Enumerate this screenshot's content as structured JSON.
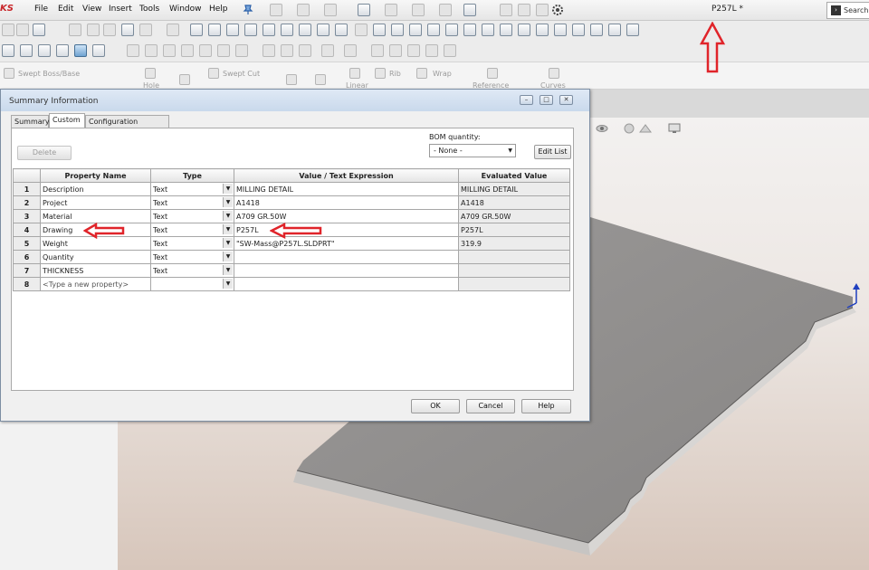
{
  "app": {
    "brand_fragment": "KS",
    "document_title": "P257L *",
    "search_label": "Search",
    "menu": [
      "File",
      "Edit",
      "View",
      "Insert",
      "Tools",
      "Window",
      "Help"
    ]
  },
  "command_manager": {
    "features": [
      "Swept Boss/Base",
      "Hole",
      "Swept Cut",
      "Linear",
      "Rib",
      "Wrap",
      "Reference",
      "Curves"
    ]
  },
  "dialog": {
    "title": "Summary Information",
    "tabs": [
      "Summary",
      "Custom",
      "Configuration Specific"
    ],
    "active_tab": "Custom",
    "delete_label": "Delete",
    "bom_label": "BOM quantity:",
    "bom_value": "- None -",
    "edit_list_label": "Edit List",
    "columns": [
      "Property Name",
      "Type",
      "Value / Text Expression",
      "Evaluated Value"
    ],
    "rows": [
      {
        "num": "1",
        "name": "Description",
        "type": "Text",
        "value": "MILLING DETAIL",
        "evaluated": "MILLING DETAIL"
      },
      {
        "num": "2",
        "name": "Project",
        "type": "Text",
        "value": "A1418",
        "evaluated": "A1418"
      },
      {
        "num": "3",
        "name": "Material",
        "type": "Text",
        "value": "A709 GR.50W",
        "evaluated": "A709 GR.50W"
      },
      {
        "num": "4",
        "name": "Drawing",
        "type": "Text",
        "value": "P257L",
        "evaluated": "P257L"
      },
      {
        "num": "5",
        "name": "Weight",
        "type": "Text",
        "value": "\"SW-Mass@P257L.SLDPRT\"",
        "evaluated": "319.9"
      },
      {
        "num": "6",
        "name": "Quantity",
        "type": "Text",
        "value": "",
        "evaluated": ""
      },
      {
        "num": "7",
        "name": "THICKNESS",
        "type": "Text",
        "value": "",
        "evaluated": ""
      },
      {
        "num": "8",
        "name": "<Type a new property>",
        "type": "",
        "value": "",
        "evaluated": ""
      }
    ],
    "ok_label": "OK",
    "cancel_label": "Cancel",
    "help_label": "Help"
  },
  "colors": {
    "annotation_arrow": "#e0242a",
    "dialog_border": "#7d8ea3",
    "part_surface": "#8e8c8b"
  },
  "icons": [
    "search-icon",
    "pin-icon",
    "new-document-icon",
    "open-icon",
    "save-icon",
    "print-icon",
    "undo-icon",
    "redo-icon",
    "select-icon",
    "rebuild-icon",
    "options-icon",
    "view-orientation-icon",
    "display-style-icon",
    "close-icon",
    "minimize-icon",
    "maximize-icon",
    "dropdown-arrow-icon",
    "triad-icon"
  ]
}
